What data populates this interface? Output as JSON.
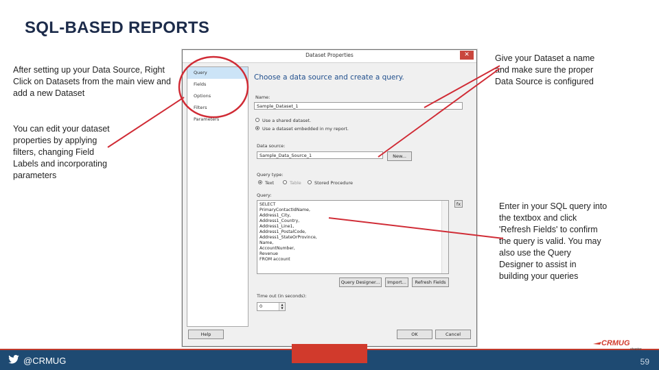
{
  "slide": {
    "title": "SQL-BASED REPORTS",
    "notes": {
      "add_dataset": "After setting up your Data Source, Right Click on Datasets from the main view and add a new Dataset",
      "edit_properties": "You can edit your dataset properties by applying filters, changing Field Labels and incorporating parameters",
      "name_dataset": "Give your Dataset a name and make sure the proper Data Source is configured",
      "sql_query": "Enter in your SQL query into the textbox and click 'Refresh Fields' to confirm the query is valid. You may also use the Query Designer to assist in building your queries"
    },
    "annotation_color": "#d02b35"
  },
  "dialog": {
    "title": "Dataset Properties",
    "close_glyph": "✕",
    "nav": [
      "Query",
      "Fields",
      "Options",
      "Filters",
      "Parameters"
    ],
    "heading": "Choose a data source and create a query.",
    "name_label": "Name:",
    "name_value": "Sample_Dataset_1",
    "radio_shared": "Use a shared dataset.",
    "radio_embedded": "Use a dataset embedded in my report.",
    "datasource_label": "Data source:",
    "datasource_value": "Sample_Data_Source_1",
    "new_button": "New...",
    "querytype_label": "Query type:",
    "querytype_options": [
      "Text",
      "Table",
      "Stored Procedure"
    ],
    "query_label": "Query:",
    "query_lines": [
      "SELECT",
      "PrimaryContactIdName,",
      "Address1_City,",
      "Address1_Country,",
      "Address1_Line1,",
      "Address1_PostalCode,",
      "Address1_StateOrProvince,",
      "Name,",
      "AccountNumber,",
      "Revenue",
      "FROM account"
    ],
    "fx_button": "fx",
    "query_designer_button": "Query Designer...",
    "import_button": "Import...",
    "refresh_button": "Refresh Fields",
    "timeout_label": "Time out (in seconds):",
    "timeout_value": "0",
    "help_button": "Help",
    "ok_button": "OK",
    "cancel_button": "Cancel"
  },
  "footer": {
    "handle": "@CRMUG",
    "logo_text": "CRMUG",
    "logo_sub": "chapter",
    "page_number": "59",
    "bar_color": "#1e4a72",
    "accent_color": "#d13a2c"
  }
}
